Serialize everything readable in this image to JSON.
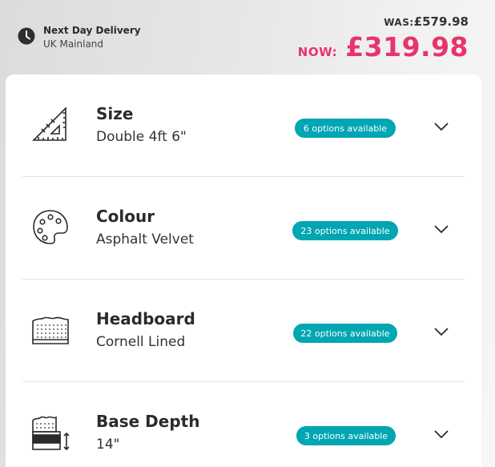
{
  "delivery": {
    "title": "Next Day Delivery",
    "subtitle": "UK Mainland",
    "icon": "clock-icon"
  },
  "price": {
    "was_label": "WAS:",
    "was_value": "£579.98",
    "now_label": "NOW:",
    "now_value": "£319.98",
    "accent_color": "#e8336b"
  },
  "badge_color": "#00a6b2",
  "options": [
    {
      "title": "Size",
      "value": "Double 4ft 6\"",
      "badge": "6 options available",
      "icon": "set-square-icon"
    },
    {
      "title": "Colour",
      "value": "Asphalt Velvet",
      "badge": "23 options available",
      "icon": "palette-icon"
    },
    {
      "title": "Headboard",
      "value": "Cornell Lined",
      "badge": "22 options available",
      "icon": "headboard-icon"
    },
    {
      "title": "Base Depth",
      "value": "14\"",
      "badge": "3 options available",
      "icon": "base-depth-icon"
    }
  ]
}
